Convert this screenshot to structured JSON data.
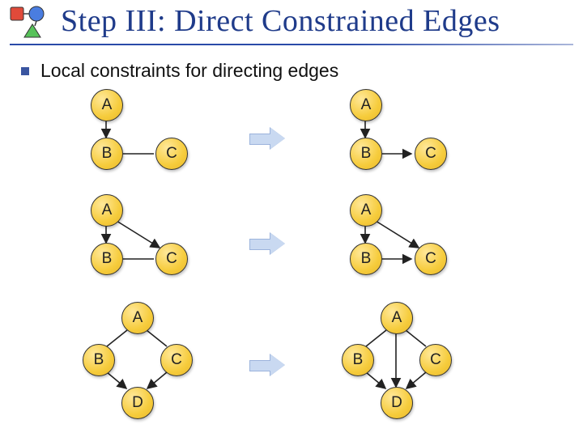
{
  "title": "Step III: Direct Constrained Edges",
  "bullet": "Local constraints for directing edges",
  "labels": {
    "A": "A",
    "B": "B",
    "C": "C",
    "D": "D"
  },
  "chart_data": {
    "type": "diagram",
    "title": "Local constraints for directing edges",
    "rules": [
      {
        "before": {
          "nodes": [
            "A",
            "B",
            "C"
          ],
          "edges": [
            {
              "from": "A",
              "to": "B",
              "directed": true
            },
            {
              "from": "B",
              "to": "C",
              "directed": false
            }
          ]
        },
        "after": {
          "nodes": [
            "A",
            "B",
            "C"
          ],
          "edges": [
            {
              "from": "A",
              "to": "B",
              "directed": true
            },
            {
              "from": "B",
              "to": "C",
              "directed": true
            }
          ]
        }
      },
      {
        "before": {
          "nodes": [
            "A",
            "B",
            "C"
          ],
          "edges": [
            {
              "from": "A",
              "to": "B",
              "directed": true
            },
            {
              "from": "A",
              "to": "C",
              "directed": true
            },
            {
              "from": "B",
              "to": "C",
              "directed": false
            }
          ]
        },
        "after": {
          "nodes": [
            "A",
            "B",
            "C"
          ],
          "edges": [
            {
              "from": "A",
              "to": "B",
              "directed": true
            },
            {
              "from": "A",
              "to": "C",
              "directed": true
            },
            {
              "from": "B",
              "to": "C",
              "directed": true
            }
          ]
        }
      },
      {
        "before": {
          "nodes": [
            "A",
            "B",
            "C",
            "D"
          ],
          "edges": [
            {
              "from": "A",
              "to": "B",
              "directed": false
            },
            {
              "from": "A",
              "to": "C",
              "directed": false
            },
            {
              "from": "B",
              "to": "D",
              "directed": true
            },
            {
              "from": "C",
              "to": "D",
              "directed": true
            }
          ]
        },
        "after": {
          "nodes": [
            "A",
            "B",
            "C",
            "D"
          ],
          "edges": [
            {
              "from": "A",
              "to": "B",
              "directed": false
            },
            {
              "from": "A",
              "to": "C",
              "directed": false
            },
            {
              "from": "B",
              "to": "D",
              "directed": true
            },
            {
              "from": "C",
              "to": "D",
              "directed": true
            },
            {
              "from": "A",
              "to": "D",
              "directed": true
            }
          ]
        }
      }
    ]
  }
}
